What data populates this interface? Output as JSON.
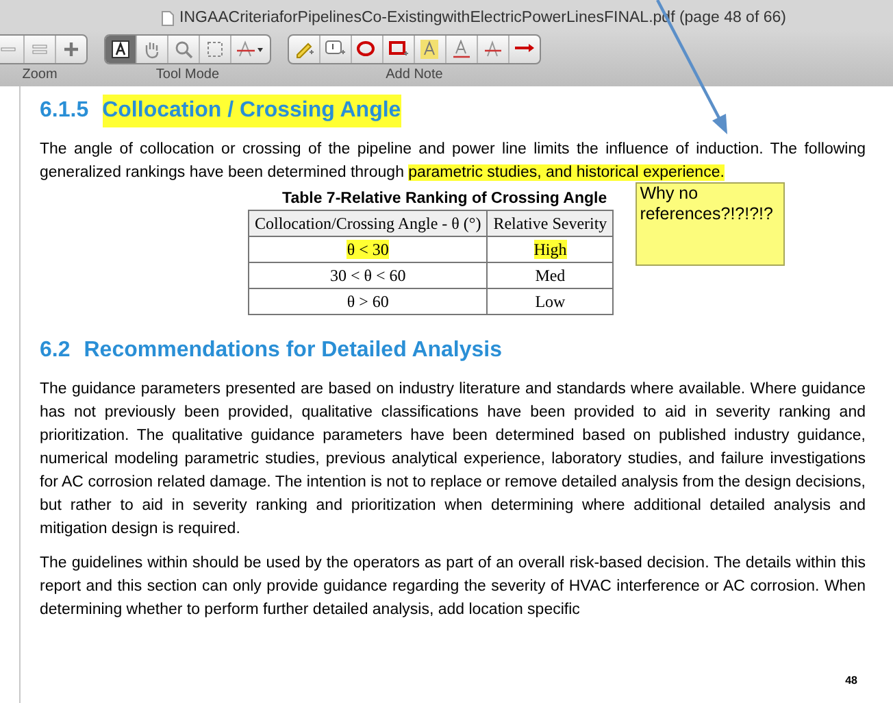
{
  "window": {
    "title": "INGAACriteriaforPipelinesCo-ExistingwithElectricPowerLinesFINAL.pdf (page 48 of 66)"
  },
  "toolbar": {
    "groups": [
      {
        "label": "Zoom",
        "tools": [
          {
            "kind": "zoom-out",
            "selected": false
          },
          {
            "kind": "actual-size",
            "selected": false
          },
          {
            "kind": "zoom-in",
            "selected": false
          }
        ]
      },
      {
        "label": "Tool Mode",
        "tools": [
          {
            "kind": "text",
            "selected": true
          },
          {
            "kind": "hand",
            "selected": false
          },
          {
            "kind": "magnify",
            "selected": false
          },
          {
            "kind": "marquee",
            "selected": false
          },
          {
            "kind": "strike-menu",
            "selected": false
          }
        ]
      },
      {
        "label": "Add Note",
        "tools": [
          {
            "kind": "pencil",
            "selected": false
          },
          {
            "kind": "note",
            "selected": false
          },
          {
            "kind": "oval",
            "selected": false
          },
          {
            "kind": "rect",
            "selected": false
          },
          {
            "kind": "highlight",
            "selected": false
          },
          {
            "kind": "underline",
            "selected": false
          },
          {
            "kind": "strike",
            "selected": false
          },
          {
            "kind": "arrow",
            "selected": false
          }
        ]
      }
    ]
  },
  "document": {
    "section1": {
      "number": "6.1.5",
      "title": "Collocation / Crossing Angle",
      "highlighted": true
    },
    "paragraph1": [
      {
        "text": "The angle of collocation or crossing of the pipeline and power line limits the influence of induction. The following generalized rankings have been determined through ",
        "highlighted": false
      },
      {
        "text": "parametric studies, and historical experience.",
        "highlighted": true
      }
    ],
    "table": {
      "caption": "Table 7-Relative Ranking of Crossing Angle",
      "columns": [
        "Collocation/Crossing Angle - θ (°)",
        "Relative Severity"
      ],
      "rows": [
        [
          {
            "text": "θ < 30",
            "highlighted": true
          },
          {
            "text": "High",
            "highlighted": true
          }
        ],
        [
          {
            "text": "30 < θ < 60",
            "highlighted": false
          },
          {
            "text": "Med",
            "highlighted": false
          }
        ],
        [
          {
            "text": "θ > 60",
            "highlighted": false
          },
          {
            "text": "Low",
            "highlighted": false
          }
        ]
      ]
    },
    "sticky_note": "Why no references?!?!?!?",
    "section2": {
      "number": "6.2",
      "title": "Recommendations for Detailed Analysis"
    },
    "paragraphs": [
      "The guidance parameters presented are based on industry literature and standards where available. Where guidance has not previously been provided, qualitative classifications have been provided to aid in severity ranking and prioritization. The qualitative guidance parameters have been determined based on published industry guidance, numerical modeling parametric studies, previous analytical experience, laboratory studies, and failure investigations for AC corrosion related damage. The intention is not to replace or remove detailed analysis from the design decisions, but rather to aid in severity ranking and prioritization when determining where additional detailed analysis and mitigation design is required.",
      "The guidelines within should be used by the operators as part of an overall risk-based decision. The details within this report and this section can only provide guidance regarding the severity of HVAC interference or AC corrosion. When determining whether to perform further detailed analysis, add location specific"
    ],
    "page_number": "48"
  }
}
